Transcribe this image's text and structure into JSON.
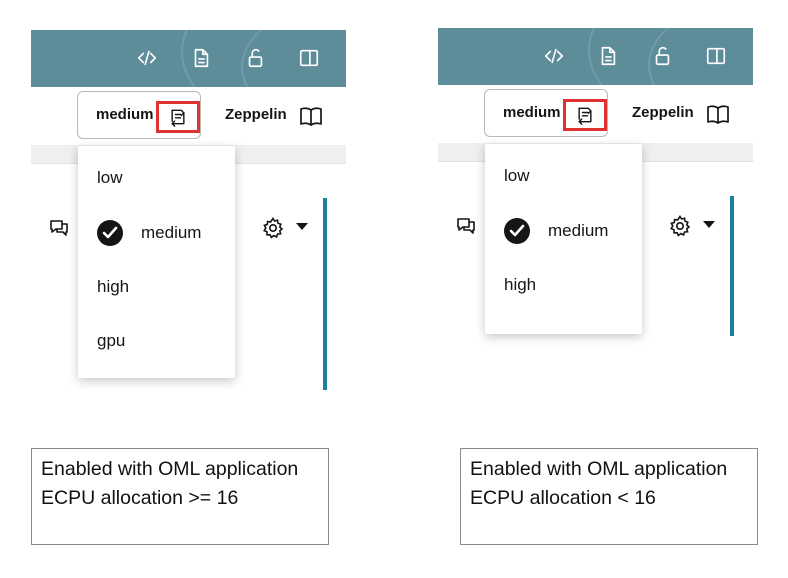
{
  "colors": {
    "header_bg": "#5e8d9a",
    "highlight_border": "#e03131",
    "accent_bar": "#1e7f9c"
  },
  "toolbar_icons": [
    "code-icon",
    "document-icon",
    "unlock-icon",
    "split-panel-icon"
  ],
  "left_panel": {
    "environment_button_label": "medium",
    "environment_icon": "switch-arrows-icon",
    "zeppelin_label": "Zeppelin",
    "zeppelin_icon": "book-icon",
    "menu_items": [
      {
        "label": "low",
        "selected": false
      },
      {
        "label": "medium",
        "selected": true
      },
      {
        "label": "high",
        "selected": false
      },
      {
        "label": "gpu",
        "selected": false
      }
    ],
    "caption": "Enabled with OML application ECPU allocation >= 16"
  },
  "right_panel": {
    "environment_button_label": "medium",
    "environment_icon": "switch-arrows-icon",
    "zeppelin_label": "Zeppelin",
    "zeppelin_icon": "book-icon",
    "menu_items": [
      {
        "label": "low",
        "selected": false
      },
      {
        "label": "medium",
        "selected": true
      },
      {
        "label": "high",
        "selected": false
      }
    ],
    "caption": "Enabled with OML application ECPU allocation < 16"
  }
}
